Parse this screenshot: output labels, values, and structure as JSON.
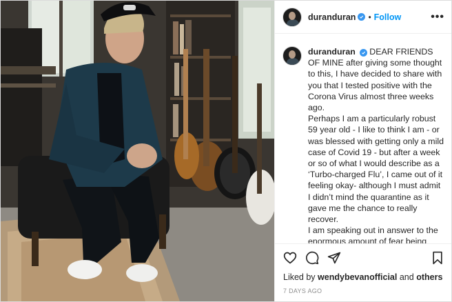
{
  "post": {
    "username": "duranduran",
    "follow_label": "Follow",
    "separator": "•",
    "more_label": "•••"
  },
  "caption": {
    "username": "duranduran",
    "text": "DEAR FRIENDS OF MINE after giving some thought to this, I have decided to share with you that I tested positive with the Corona Virus almost three weeks ago.\nPerhaps I am a particularly robust 59 year old - I like to think I am - or was blessed with getting only a mild case of Covid 19 - but after a week or so of what I would describe as a ‘Turbo-charged Flu’, I came out of it feeling okay- although I must admit I didn’t mind the quarantine as it gave me the chance to really recover.\nI am speaking out in answer to the enormous amount of fear being generated by the pandemic, some of it entirely justified, and my heart goes out to everyone who has had to deal with real loss and pain. But I want to"
  },
  "likes": {
    "prefix": "Liked by",
    "user": "wendybevanofficial",
    "conjunction": "and",
    "others": "others"
  },
  "timestamp": "7 DAYS AGO",
  "icons": {
    "like": "heart-icon",
    "comment": "comment-icon",
    "share": "share-icon",
    "save": "bookmark-icon",
    "verified": "verified-badge-icon"
  },
  "colors": {
    "link": "#0095f6",
    "verified": "#3897f0",
    "muted": "#8e8e8e"
  }
}
